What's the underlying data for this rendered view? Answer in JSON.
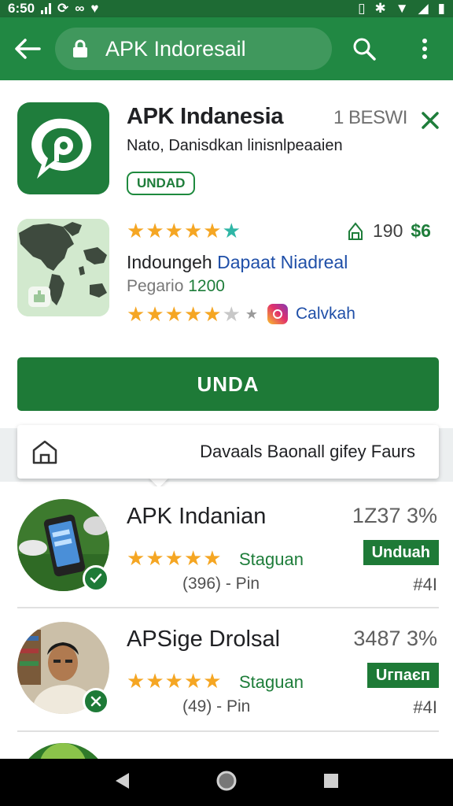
{
  "status_bar": {
    "time": "6:50"
  },
  "app_bar": {
    "search_text": "APK Indoresail"
  },
  "featured": {
    "title": "APK Indanesia",
    "meta": "1 BESWI",
    "subtitle": "Nato, Danisdkan linisnlpeaaien",
    "badge": "UNDAD"
  },
  "second_app": {
    "rating_count": "190",
    "price": "$6",
    "line1_prefix": "Indoungeh",
    "line1_link": "Dapaat Niadreal",
    "line2_prefix": "Pegario",
    "line2_number": "1200",
    "badge_label": "Calvkah"
  },
  "primary_button": {
    "label": "UNDA"
  },
  "popup": {
    "text": "Davaals Baonall gifey Faurs"
  },
  "list": [
    {
      "title": "APK Indanian",
      "stat": "1Z37 3%",
      "category": "Staguan",
      "meta": "(396) - Pin",
      "button": "Unduah",
      "rank": "#4I",
      "rating": 5
    },
    {
      "title": "APSige Drolsal",
      "stat": "3487 3%",
      "category": "Staguan",
      "meta": "(49) - Pin",
      "button": "Uгпаєп",
      "rank": "#4I",
      "rating": 5
    }
  ],
  "colors": {
    "brand_green": "#218843",
    "dark_green": "#1e7a37",
    "star": "#f5a623",
    "link_blue": "#1f4fa8"
  }
}
